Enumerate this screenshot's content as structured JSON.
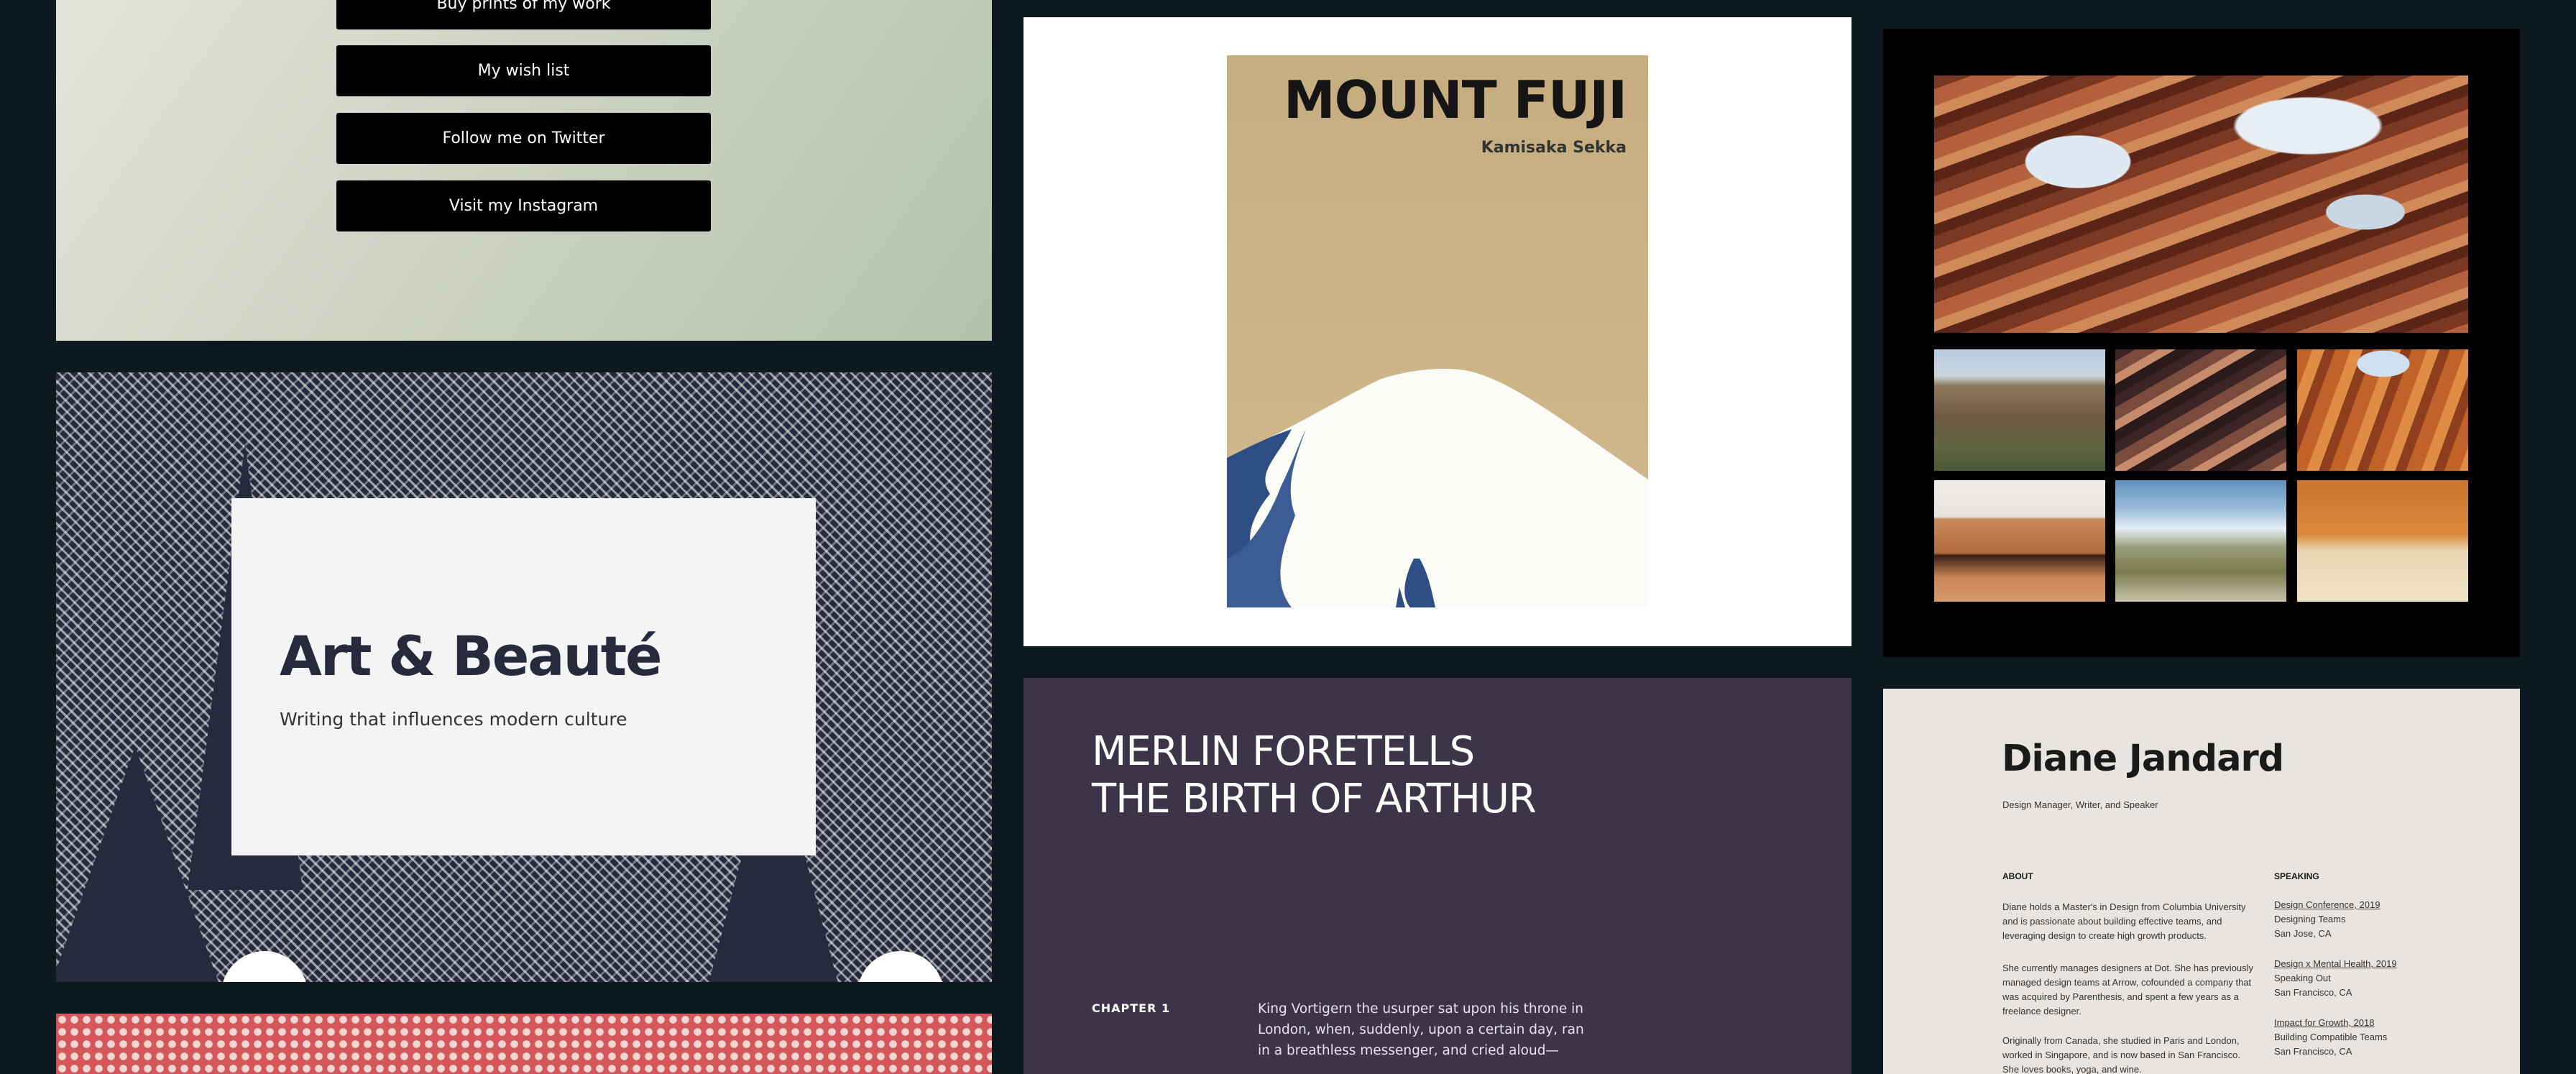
{
  "links": {
    "buttons": [
      "Buy prints of my work",
      "My wish list",
      "Follow me on Twitter",
      "Visit my Instagram"
    ]
  },
  "art": {
    "title": "Art & Beauté",
    "subtitle": "Writing that influences modern culture"
  },
  "fuji": {
    "title": "MOUNT FUJI",
    "artist": "Kamisaka Sekka"
  },
  "merlin": {
    "title_lines": [
      "MERLIN FORETELLS",
      "THE BIRTH OF ARTHUR"
    ],
    "chapter": "CHAPTER 1",
    "text_lines": [
      "King Vortigern the usurper sat upon his throne in",
      "London, when, suddenly, upon a certain day, ran",
      "in a breathless messenger, and cried aloud—"
    ]
  },
  "resume": {
    "name": "Diane Jandard",
    "role": "Design Manager, Writer, and Speaker",
    "about_heading": "ABOUT",
    "speaking_heading": "SPEAKING",
    "about_lines": [
      "Diane holds a Master's in Design from Columbia University",
      "and is passionate about building effective teams, and",
      "leveraging design to create high growth products.",
      "She currently manages designers at Dot. She has previously",
      "managed design teams at Arrow, cofounded a company that",
      "was acquired by Parenthesis, and spent a few years as a",
      "freelance designer.",
      "Originally from Canada, she studied in Paris and London,",
      "worked in Singapore, and is now based in San Francisco.",
      "She loves books, yoga, and wine."
    ],
    "speaking": [
      {
        "event": "Design Conference, 2019",
        "talk": "Designing Teams",
        "place": "San Jose, CA"
      },
      {
        "event": "Design x Mental Health, 2019",
        "talk": "Speaking Out",
        "place": "San Francisco, CA"
      },
      {
        "event": "Impact for Growth, 2018",
        "talk": "Building Compatible Teams",
        "place": "San Francisco, CA"
      }
    ]
  },
  "colors": {
    "background": "#0c1920",
    "merlin_bg": "#3c3549",
    "art_ink": "#262a3c",
    "dots_red": "#d3575b"
  }
}
